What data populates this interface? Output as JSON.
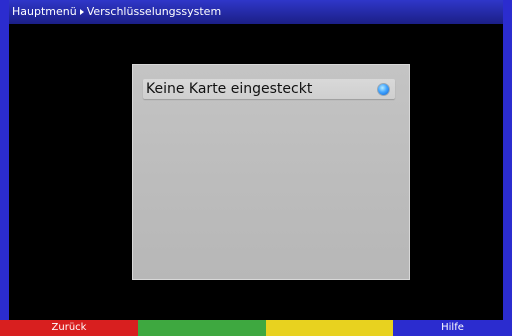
{
  "header": {
    "crumb_root": "Hauptmenü",
    "crumb_current": "Verschlüsselungssystem"
  },
  "panel": {
    "row_label": "Keine Karte eingesteckt"
  },
  "footer": {
    "red_label": "Zurück",
    "green_label": "",
    "yellow_label": "",
    "blue_label": "Hilfe"
  },
  "colors": {
    "titlebar": "#2f37c9",
    "panel": "#c0c0c0",
    "red_key": "#d81f1f",
    "green_key": "#3ea840",
    "yellow_key": "#e8d21f",
    "blue_key": "#2b2ccf"
  },
  "icons": {
    "breadcrumb_separator": "arrow-right-icon",
    "row_indicator": "selection-dot-icon"
  }
}
